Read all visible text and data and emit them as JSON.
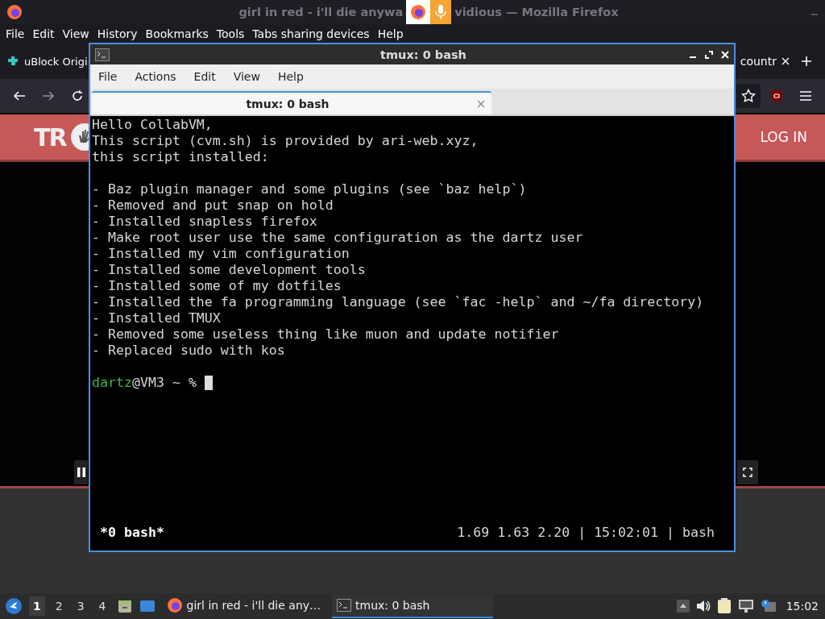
{
  "firefox": {
    "title_left": "girl in red - i'll die anywa",
    "title_right": "vidious — Mozilla Firefox",
    "menu": [
      "File",
      "Edit",
      "View",
      "History",
      "Bookmarks",
      "Tools",
      "Tabs sharing devices",
      "Help"
    ],
    "tabs": [
      {
        "label": "uBlock Origi",
        "kind": "extension"
      },
      {
        "label": "countr",
        "kind": "page"
      }
    ],
    "page": {
      "logo": "TR",
      "login": "LOG IN"
    }
  },
  "terminal": {
    "title": "tmux: 0 bash",
    "menu": [
      "File",
      "Actions",
      "Edit",
      "View",
      "Help"
    ],
    "tab": "tmux: 0 bash",
    "blocks": [
      {
        "lines": [
          "Hello CollabVM,",
          "This script (cvm.sh) is provided by ari-web.xyz,",
          "this script installed:"
        ]
      },
      {
        "lines": [
          "- Baz plugin manager and some plugins (see `baz help`)",
          "- Removed and put snap on hold",
          "- Installed snapless firefox",
          "- Make root user use the same configuration as the dartz user",
          "- Installed my vim configuration",
          "- Installed some development tools",
          "- Installed some of my dotfiles",
          "- Installed the fa programming language (see `fac -help` and ~/fa directory)",
          "- Installed TMUX",
          "- Removed some useless thing like muon and update notifier",
          "- Replaced sudo with kos"
        ]
      }
    ],
    "prompt": {
      "user": "dartz",
      "rest": "@VM3 ~ %"
    },
    "status": {
      "left": "*0 bash*",
      "right": "1.69 1.63 2.20 | 15:02:01 | bash"
    }
  },
  "taskbar": {
    "workspaces": [
      {
        "label": "1",
        "selected": true
      },
      {
        "label": "2",
        "selected": false
      },
      {
        "label": "3",
        "selected": false
      },
      {
        "label": "4",
        "selected": false
      }
    ],
    "tasks": [
      {
        "label": "girl in red - i'll die any…",
        "kind": "browser",
        "selected": false
      },
      {
        "label": "tmux: 0 bash",
        "kind": "terminal",
        "selected": true
      }
    ],
    "clock": "15:02"
  }
}
